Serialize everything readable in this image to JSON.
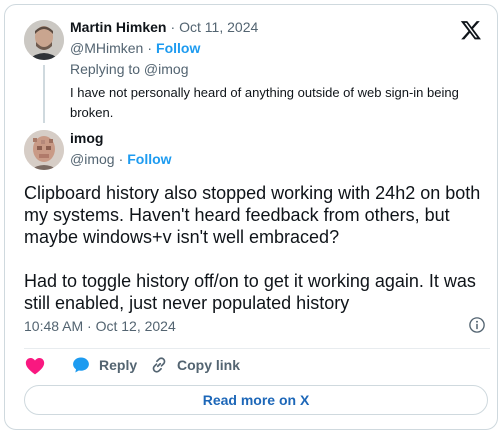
{
  "reply_tweet": {
    "author_name": "Martin Himken",
    "date": "Oct 11, 2024",
    "handle": "@MHimken",
    "follow_label": "Follow",
    "replying_to": "Replying to @imog",
    "text": "I have not personally heard of anything outside of web sign-in being broken."
  },
  "main_tweet": {
    "author_name": "imog",
    "handle": "@imog",
    "follow_label": "Follow",
    "text_line1": "Clipboard history also stopped working with 24h2 on both",
    "text_line2": "my systems. Haven't heard feedback from others, but",
    "text_line3": "maybe windows+v isn't well embraced?",
    "text_line4": "Had to toggle history off/on to get it working again. It was",
    "text_line5": "still enabled, just never populated history",
    "timestamp": "10:48 AM · Oct 12, 2024"
  },
  "actions": {
    "reply_label": "Reply",
    "copy_link_label": "Copy link",
    "read_more_label": "Read more on X"
  },
  "colors": {
    "accent": "#1d9bf0",
    "heart": "#f91880",
    "muted": "#536471",
    "border": "#cfd9de"
  },
  "icons": {
    "brand": "x-logo-icon",
    "like": "heart-icon",
    "reply": "speech-bubble-icon",
    "copy": "link-icon",
    "info": "info-icon"
  }
}
